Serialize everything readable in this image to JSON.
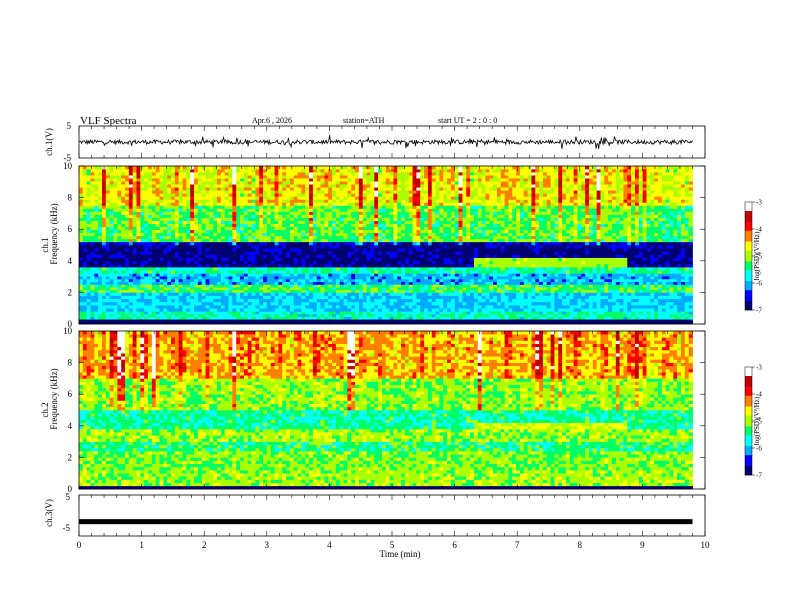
{
  "header": {
    "title": "VLF  Spectra",
    "date": "Apr.6  , 2026",
    "station": "station=ATH",
    "start": "start  UT  =   2 : 0  : 0"
  },
  "chart_data": [
    {
      "type": "line",
      "panel": "ch1-waveform",
      "ylabel": "ch.1(V)",
      "ylim": [
        -5,
        5
      ],
      "yticks": [
        "5",
        "-5"
      ],
      "xlim": [
        0,
        10
      ],
      "trace_color": "#000000",
      "trace_extent_min": [
        0,
        9.8
      ],
      "amplitude_hint_V": [
        -1.5,
        1.5
      ]
    },
    {
      "type": "heatmap",
      "panel": "ch1-spectrogram",
      "ylabel": [
        "ch.1",
        "Frequency  (kHz)"
      ],
      "ylim": [
        0,
        10
      ],
      "yticks": [
        "0",
        "2",
        "4",
        "6",
        "8",
        "10"
      ],
      "xlim": [
        0,
        10
      ],
      "data_extent_min": [
        0,
        9.8
      ],
      "colorbar": {
        "label": "log(PSD)(V²/Hz)",
        "range": [
          -7,
          -3
        ],
        "ticks": [
          "-3",
          "-4",
          "-5",
          "-6",
          "-7"
        ],
        "colors": [
          "#000070",
          "#0000ff",
          "#00aaff",
          "#00ffff",
          "#00ff66",
          "#aaff00",
          "#ffff00",
          "#ff8000",
          "#ff0000",
          "#c00000",
          "#ffffff"
        ]
      },
      "bands": [
        {
          "f": [
            0.0,
            0.3
          ],
          "level": -7.0
        },
        {
          "f": [
            0.3,
            0.8
          ],
          "level": -5.6
        },
        {
          "f": [
            0.8,
            2.0
          ],
          "level": -5.9
        },
        {
          "f": [
            2.0,
            2.5
          ],
          "level": -5.3
        },
        {
          "f": [
            2.5,
            3.2
          ],
          "level": -6.0
        },
        {
          "f": [
            3.2,
            3.6
          ],
          "level": -5.5
        },
        {
          "f": [
            3.6,
            5.2
          ],
          "level": -6.8
        },
        {
          "f": [
            5.2,
            7.5
          ],
          "level": -5.4
        },
        {
          "f": [
            7.5,
            10.0
          ],
          "level": -4.9
        }
      ],
      "events": [
        {
          "t": [
            6.25,
            8.7
          ],
          "f": [
            3.6,
            4.3
          ],
          "level": -5.0
        }
      ]
    },
    {
      "type": "heatmap",
      "panel": "ch2-spectrogram",
      "ylabel": [
        "ch.2",
        "Frequency  (kHz)"
      ],
      "ylim": [
        0,
        10
      ],
      "yticks": [
        "0",
        "2",
        "4",
        "6",
        "8",
        "10"
      ],
      "xlim": [
        0,
        10
      ],
      "data_extent_min": [
        0,
        9.8
      ],
      "colorbar": {
        "label": "log(PSD)(V²/Hz)",
        "range": [
          -7,
          -3
        ],
        "ticks": [
          "-3",
          "-4",
          "-5",
          "-6",
          "-7"
        ],
        "colors": [
          "#000070",
          "#0000ff",
          "#00aaff",
          "#00ffff",
          "#00ff66",
          "#aaff00",
          "#ffff00",
          "#ff8000",
          "#ff0000",
          "#c00000",
          "#ffffff"
        ]
      },
      "bands": [
        {
          "f": [
            0.0,
            0.2
          ],
          "level": -7.0
        },
        {
          "f": [
            0.2,
            1.2
          ],
          "level": -5.0
        },
        {
          "f": [
            1.2,
            2.4
          ],
          "level": -5.1
        },
        {
          "f": [
            2.4,
            3.0
          ],
          "level": -5.4
        },
        {
          "f": [
            3.0,
            3.8
          ],
          "level": -5.0
        },
        {
          "f": [
            3.8,
            5.0
          ],
          "level": -5.5
        },
        {
          "f": [
            5.0,
            7.0
          ],
          "level": -5.2
        },
        {
          "f": [
            7.0,
            10.0
          ],
          "level": -4.6
        }
      ],
      "events": [
        {
          "t": [
            6.25,
            8.7
          ],
          "f": [
            3.6,
            4.3
          ],
          "level": -4.8
        }
      ]
    },
    {
      "type": "line",
      "panel": "ch3-waveform",
      "ylabel": "ch.3(V)",
      "ylim": [
        -5,
        5
      ],
      "yticks": [
        "5",
        "-5"
      ],
      "xlim": [
        0,
        10
      ],
      "xticks": [
        "0",
        "1",
        "2",
        "3",
        "4",
        "5",
        "6",
        "7",
        "8",
        "9",
        "10"
      ],
      "xlabel": "Time  (min)",
      "trace_color": "#000000",
      "trace_level_V": -1.5,
      "trace_extent_min": [
        0,
        9.8
      ]
    }
  ]
}
